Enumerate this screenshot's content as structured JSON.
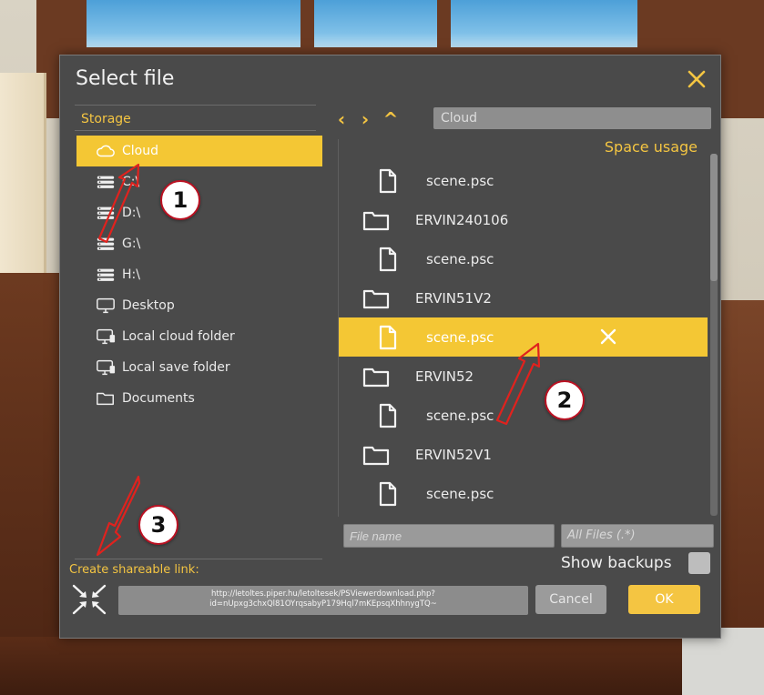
{
  "dialog": {
    "title": "Select file",
    "close_icon": "close-icon"
  },
  "storage": {
    "heading": "Storage",
    "items": [
      {
        "label": "Cloud",
        "icon": "cloud-icon",
        "selected": true
      },
      {
        "label": "C:\\",
        "icon": "drive-icon",
        "selected": false
      },
      {
        "label": "D:\\",
        "icon": "drive-icon",
        "selected": false
      },
      {
        "label": "G:\\",
        "icon": "drive-icon",
        "selected": false
      },
      {
        "label": "H:\\",
        "icon": "drive-icon",
        "selected": false
      },
      {
        "label": "Desktop",
        "icon": "monitor-icon",
        "selected": false
      },
      {
        "label": "Local cloud folder",
        "icon": "local-cloud-folder-icon",
        "selected": false
      },
      {
        "label": "Local save folder",
        "icon": "local-save-folder-icon",
        "selected": false
      },
      {
        "label": "Documents",
        "icon": "folder-icon",
        "selected": false
      }
    ]
  },
  "navigation": {
    "back": "‹",
    "forward": "›",
    "up": "^",
    "path": "Cloud"
  },
  "files": {
    "space_usage": "Space usage",
    "rows": [
      {
        "name": "scene.psc",
        "type": "file",
        "selected": false
      },
      {
        "name": "ERVIN240106",
        "type": "folder",
        "selected": false
      },
      {
        "name": "scene.psc",
        "type": "file",
        "selected": false
      },
      {
        "name": "ERVIN51V2",
        "type": "folder",
        "selected": false
      },
      {
        "name": "scene.psc",
        "type": "file",
        "selected": true
      },
      {
        "name": "ERVIN52",
        "type": "folder",
        "selected": false
      },
      {
        "name": "scene.psc",
        "type": "file",
        "selected": false
      },
      {
        "name": "ERVIN52V1",
        "type": "folder",
        "selected": false
      },
      {
        "name": "scene.psc",
        "type": "file",
        "selected": false
      }
    ]
  },
  "footer": {
    "filename_placeholder": "File name",
    "filter_value": "All Files (.*)",
    "show_backups_label": "Show backups",
    "share_label": "Create shareable link:",
    "share_link": "http://letoltes.piper.hu/letoltesek/PSViewerdownload.php?id=nUpxg3chxQl81OYrqsabyP179Hql7mKEpsqXhhnygTQ~",
    "cancel_label": "Cancel",
    "ok_label": "OK"
  },
  "annotations": {
    "badges": [
      "1",
      "2",
      "3"
    ],
    "arrow_color": "#e0221e"
  },
  "colors": {
    "accent": "#f4c542",
    "panel": "#4a4a4a",
    "selected": "#f4c734"
  }
}
